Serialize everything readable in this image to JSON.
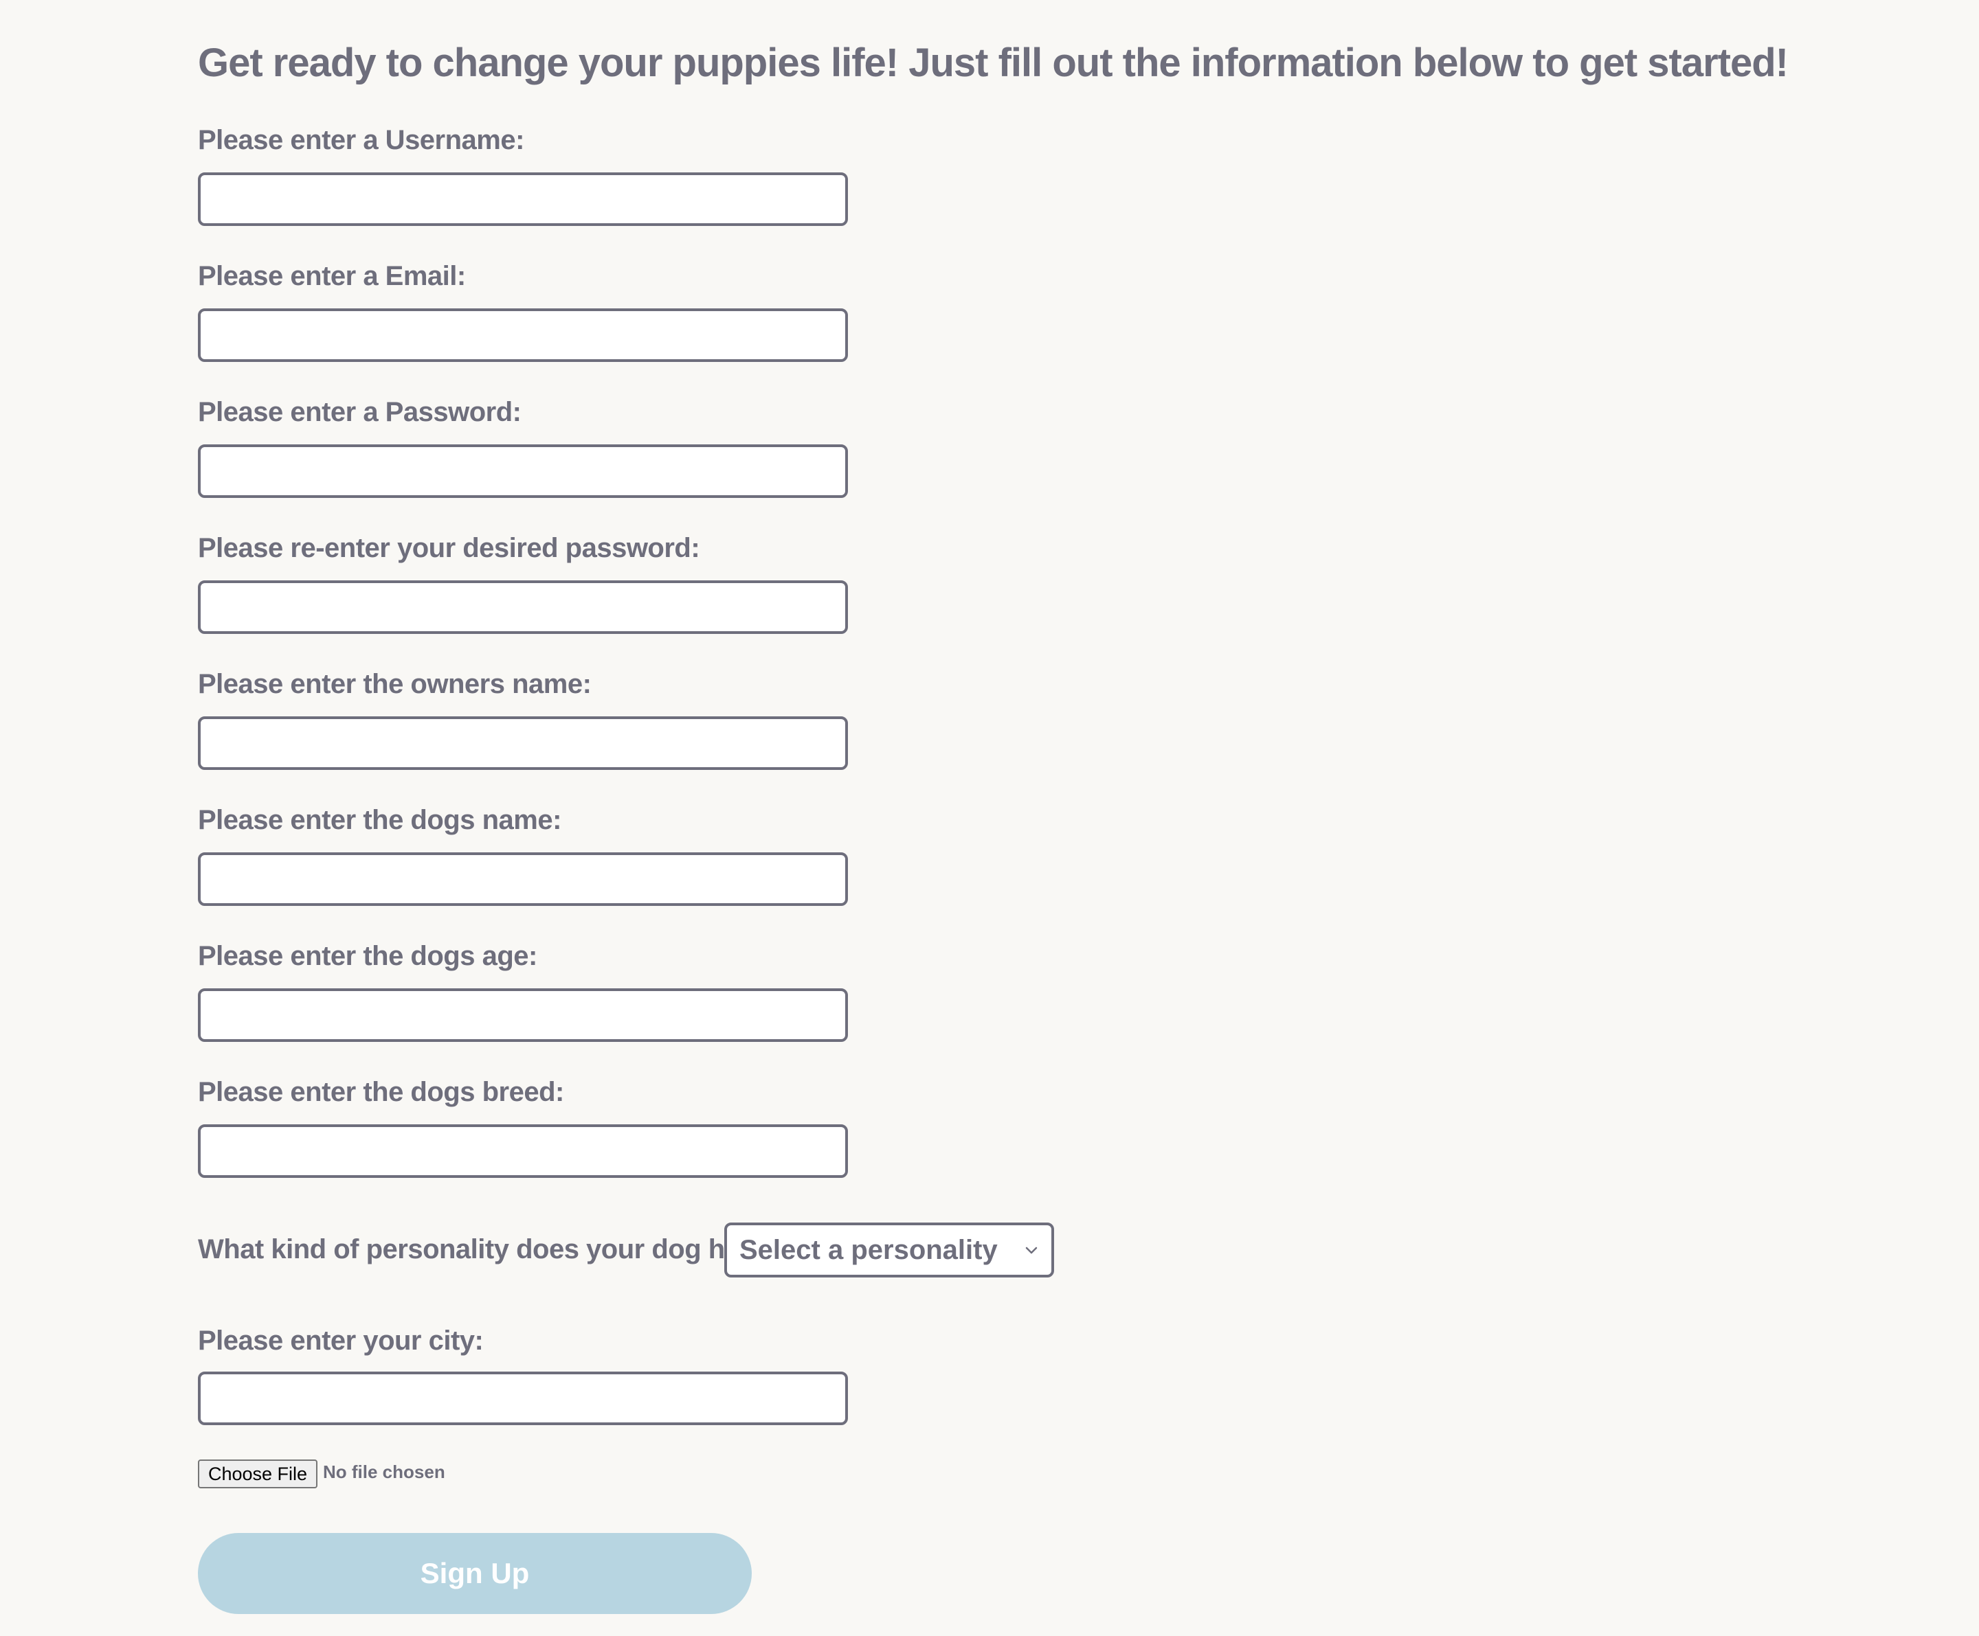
{
  "form": {
    "heading": "Get ready to change your puppies life! Just fill out the information below to get started!",
    "fields": [
      {
        "label": "Please enter a Username:",
        "value": ""
      },
      {
        "label": "Please enter a Email:",
        "value": ""
      },
      {
        "label": "Please enter a Password:",
        "value": ""
      },
      {
        "label": "Please re-enter your desired password:",
        "value": ""
      },
      {
        "label": "Please enter the owners name:",
        "value": ""
      },
      {
        "label": "Please enter the dogs name:",
        "value": ""
      },
      {
        "label": "Please enter the dogs age:",
        "value": ""
      },
      {
        "label": "Please enter the dogs breed:",
        "value": ""
      }
    ],
    "personality": {
      "label": "What kind of personality does your dog have?",
      "selected": "Select a personality",
      "icon": "chevron-down-icon"
    },
    "city": {
      "label": "Please enter your city:",
      "value": ""
    },
    "file": {
      "button_label": "Choose File",
      "status": "No file chosen"
    },
    "submit_label": "Sign Up"
  },
  "colors": {
    "background": "#f9f8f5",
    "text": "#6e6e7c",
    "input_border": "#6e6e7c",
    "button_bg": "#b7d5e1",
    "button_text": "#ffffff"
  }
}
